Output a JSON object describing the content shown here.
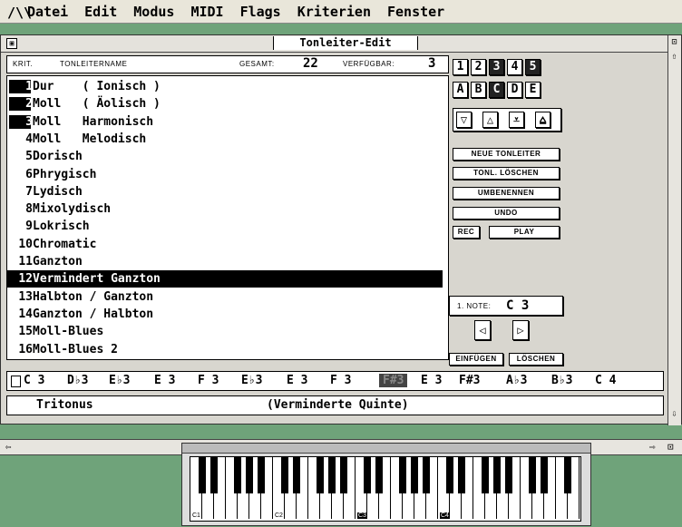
{
  "menubar": {
    "logo": "/\\\\",
    "items": [
      "Datei",
      "Edit",
      "Modus",
      "MIDI",
      "Flags",
      "Kriterien",
      "Fenster"
    ]
  },
  "window": {
    "title": "Tonleiter-Edit"
  },
  "header": {
    "krit_label": "KRIT.",
    "name_label": "TONLEITERNAME",
    "gesamt_label": "GESAMT:",
    "gesamt_value": "22",
    "verfuegbar_label": "VERFÜGBAR:",
    "verfuegbar_value": "3"
  },
  "scales": [
    {
      "num": "1",
      "name": "Dur    ( Ionisch )"
    },
    {
      "num": "2",
      "name": "Moll   ( Äolisch )"
    },
    {
      "num": "3",
      "name": "Moll   Harmonisch"
    },
    {
      "num": "4",
      "name": "Moll   Melodisch"
    },
    {
      "num": "5",
      "name": "Dorisch"
    },
    {
      "num": "6",
      "name": "Phrygisch"
    },
    {
      "num": "7",
      "name": "Lydisch"
    },
    {
      "num": "8",
      "name": "Mixolydisch"
    },
    {
      "num": "9",
      "name": "Lokrisch"
    },
    {
      "num": "10",
      "name": "Chromatic"
    },
    {
      "num": "11",
      "name": "Ganzton"
    },
    {
      "num": "12",
      "name": "Vermindert Ganzton"
    },
    {
      "num": "13",
      "name": "Halbton / Ganzton"
    },
    {
      "num": "14",
      "name": "Ganzton / Halbton"
    },
    {
      "num": "15",
      "name": "Moll-Blues"
    },
    {
      "num": "16",
      "name": "Moll-Blues 2"
    }
  ],
  "selected_index": 11,
  "number_buttons": [
    "1",
    "2",
    "3",
    "4",
    "5"
  ],
  "letter_buttons": [
    "A",
    "B",
    "C",
    "D",
    "E"
  ],
  "arrow_buttons": [
    "▽",
    "△",
    "⩡",
    "⩠"
  ],
  "actions": {
    "neue": "NEUE TONLEITER",
    "loeschen_tonl": "TONL. LÖSCHEN",
    "umbenennen": "UMBENENNEN",
    "undo": "UNDO",
    "rec": "REC",
    "play": "PLAY",
    "note_label": "1. NOTE:",
    "note_value": "C 3",
    "einfuegen": "EINFÜGEN",
    "loeschen": "LÖSCHEN"
  },
  "notes": [
    "C 3",
    "D♭3",
    "E♭3",
    "E 3",
    "F 3",
    "E♭3",
    "E 3",
    "F 3",
    "F#3",
    "E 3",
    "F#3",
    "A♭3",
    "B♭3",
    "C 4"
  ],
  "interval": {
    "name": "Tritonus",
    "desc": "(Verminderte Quinte)"
  },
  "keyboard": {
    "labels": [
      "C1",
      "C2",
      "C3",
      "C4"
    ]
  }
}
